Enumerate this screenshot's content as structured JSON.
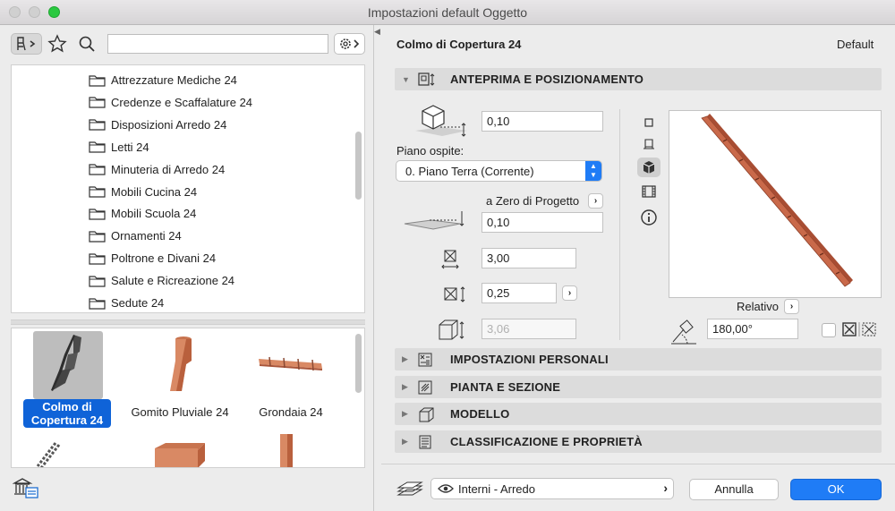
{
  "window": {
    "title": "Impostazioni default Oggetto"
  },
  "left": {
    "search": {
      "value": "",
      "placeholder": ""
    },
    "folders": [
      "Attrezzature Mediche 24",
      "Credenze e Scaffalature 24",
      "Disposizioni Arredo 24",
      "Letti 24",
      "Minuteria di Arredo 24",
      "Mobili Cucina 24",
      "Mobili Scuola 24",
      "Ornamenti 24",
      "Poltrone e Divani 24",
      "Salute e Ricreazione 24",
      "Sedute 24"
    ],
    "thumbs": [
      {
        "label_line1": "Colmo di",
        "label_line2": "Copertura 24",
        "selected": true
      },
      {
        "label": "Gomito Pluviale 24"
      },
      {
        "label": "Grondaia 24"
      }
    ]
  },
  "right": {
    "object_name": "Colmo di Copertura 24",
    "default_label": "Default",
    "sections": {
      "preview": "ANTEPRIMA E POSIZIONAMENTO",
      "custom": "IMPOSTAZIONI PERSONALI",
      "plan": "PIANTA E SEZIONE",
      "model": "MODELLO",
      "classification": "CLASSIFICAZIONE E PROPRIETÀ"
    },
    "elevation_value": "0,10",
    "host_story_label": "Piano ospite:",
    "host_story_value": "0. Piano Terra (Corrente)",
    "zero_label": "a Zero di Progetto",
    "zero_value": "0,10",
    "width_value": "3,00",
    "depth_value": "0,25",
    "height_value": "3,06",
    "relative_label": "Relativo",
    "rotation_value": "180,00°"
  },
  "footer": {
    "layer_value": "Interni - Arredo",
    "cancel_label": "Annulla",
    "ok_label": "OK"
  },
  "colors": {
    "accent": "#0f63d8",
    "ok_button": "#1f7cf6",
    "ridge": "#b9553a"
  }
}
